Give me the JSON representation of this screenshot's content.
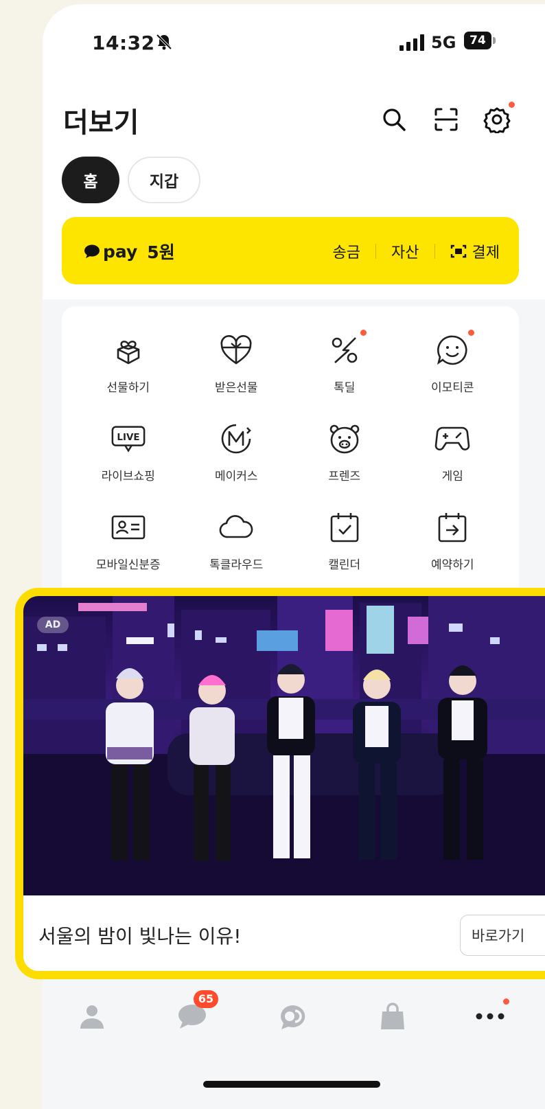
{
  "status": {
    "time": "14:32",
    "network": "5G",
    "battery": "74"
  },
  "header": {
    "title": "더보기"
  },
  "segments": [
    {
      "label": "홈"
    },
    {
      "label": "지갑"
    }
  ],
  "pay": {
    "brand": "pay",
    "amount": "5원",
    "links": [
      {
        "label": "송금"
      },
      {
        "label": "자산"
      },
      {
        "label": "결제"
      }
    ]
  },
  "grid": [
    {
      "label": "선물하기",
      "icon": "gift-icon"
    },
    {
      "label": "받은선물",
      "icon": "received-gift-icon"
    },
    {
      "label": "톡딜",
      "icon": "deal-icon"
    },
    {
      "label": "이모티콘",
      "icon": "emoticon-icon"
    },
    {
      "label": "라이브쇼핑",
      "icon": "live-shopping-icon"
    },
    {
      "label": "메이커스",
      "icon": "makers-icon"
    },
    {
      "label": "프렌즈",
      "icon": "friends-icon"
    },
    {
      "label": "게임",
      "icon": "game-icon"
    },
    {
      "label": "모바일신분증",
      "icon": "id-card-icon"
    },
    {
      "label": "톡클라우드",
      "icon": "cloud-icon"
    },
    {
      "label": "캘린더",
      "icon": "calendar-icon"
    },
    {
      "label": "예약하기",
      "icon": "reservation-icon"
    }
  ],
  "ad": {
    "badge": "AD",
    "headline": "서울의 밤이 빛나는 이유!",
    "cta": "바로가기"
  },
  "tabbar": {
    "chat_badge": "65"
  },
  "colors": {
    "kakao_yellow": "#fde500",
    "notify_red": "#ff5a3c",
    "ad_border": "#fddd00"
  }
}
